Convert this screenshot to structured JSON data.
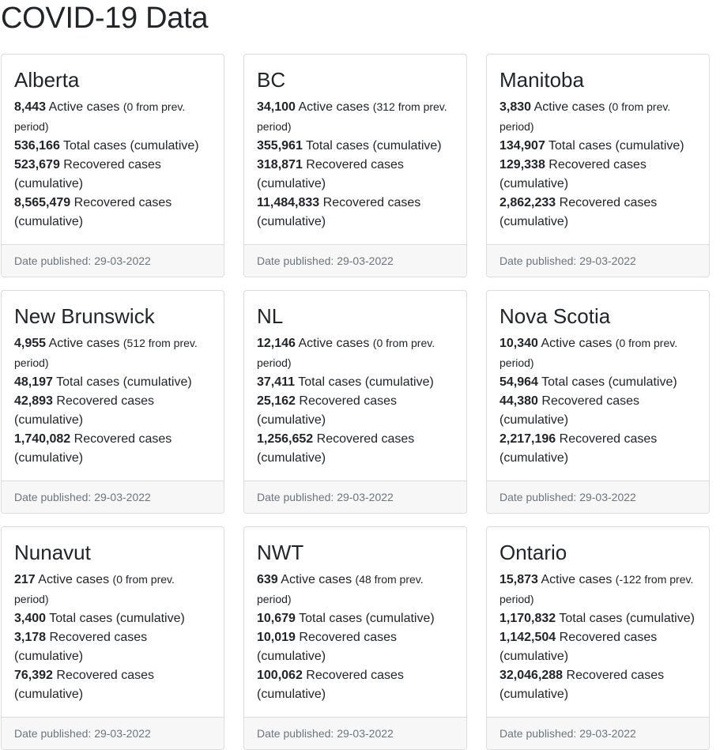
{
  "page": {
    "title": "COVID-19 Data"
  },
  "labels": {
    "active_suffix": "Active cases",
    "from_prev_tail": "from prev. period",
    "total_suffix": "Total cases (cumulative)",
    "recovered_suffix": "Recovered cases (cumulative)",
    "date_prefix": "Date published:"
  },
  "provinces": [
    {
      "name": "Alberta",
      "active": "8,443",
      "change": "0",
      "total": "536,166",
      "recovered": "523,679",
      "recovered2": "8,565,479",
      "date": "29-03-2022"
    },
    {
      "name": "BC",
      "active": "34,100",
      "change": "312",
      "total": "355,961",
      "recovered": "318,871",
      "recovered2": "11,484,833",
      "date": "29-03-2022"
    },
    {
      "name": "Manitoba",
      "active": "3,830",
      "change": "0",
      "total": "134,907",
      "recovered": "129,338",
      "recovered2": "2,862,233",
      "date": "29-03-2022"
    },
    {
      "name": "New Brunswick",
      "active": "4,955",
      "change": "512",
      "total": "48,197",
      "recovered": "42,893",
      "recovered2": "1,740,082",
      "date": "29-03-2022"
    },
    {
      "name": "NL",
      "active": "12,146",
      "change": "0",
      "total": "37,411",
      "recovered": "25,162",
      "recovered2": "1,256,652",
      "date": "29-03-2022"
    },
    {
      "name": "Nova Scotia",
      "active": "10,340",
      "change": "0",
      "total": "54,964",
      "recovered": "44,380",
      "recovered2": "2,217,196",
      "date": "29-03-2022"
    },
    {
      "name": "Nunavut",
      "active": "217",
      "change": "0",
      "total": "3,400",
      "recovered": "3,178",
      "recovered2": "76,392",
      "date": "29-03-2022"
    },
    {
      "name": "NWT",
      "active": "639",
      "change": "48",
      "total": "10,679",
      "recovered": "10,019",
      "recovered2": "100,062",
      "date": "29-03-2022"
    },
    {
      "name": "Ontario",
      "active": "15,873",
      "change": "-122",
      "total": "1,170,832",
      "recovered": "1,142,504",
      "recovered2": "32,046,288",
      "date": "29-03-2022"
    }
  ]
}
